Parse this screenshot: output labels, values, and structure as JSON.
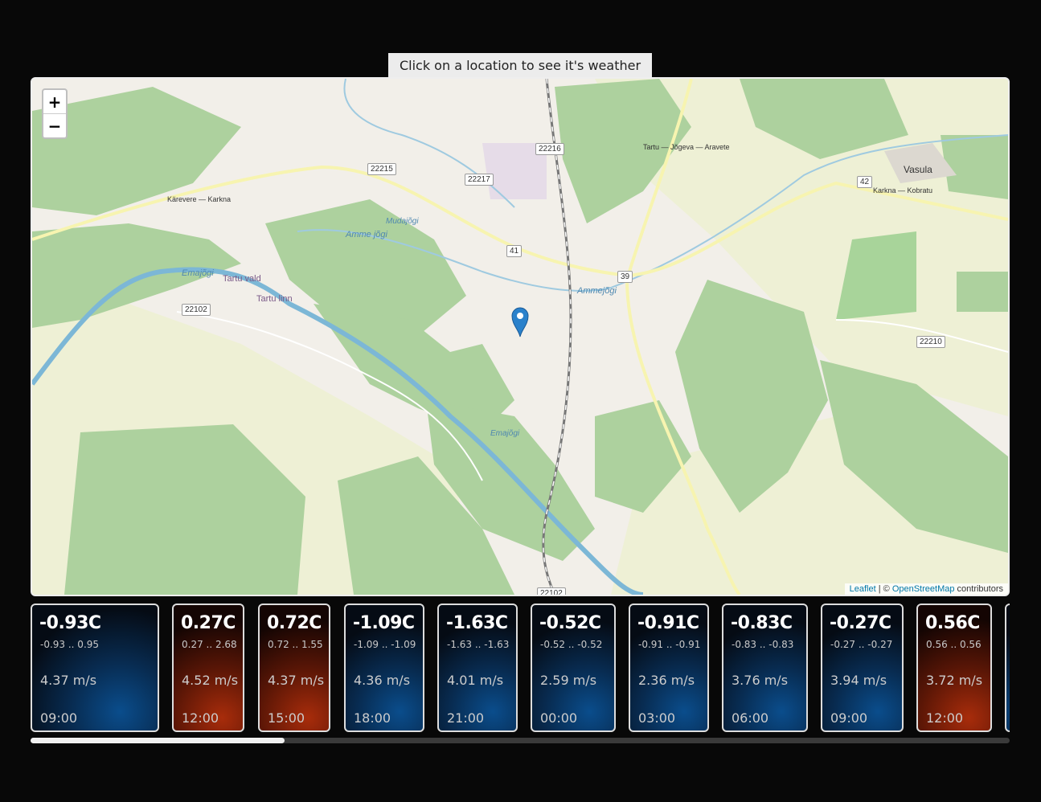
{
  "hint": "Click on a location to see it's weather",
  "map": {
    "zoom_in": "+",
    "zoom_out": "−",
    "attribution": {
      "leaflet": "Leaflet",
      "separator": " | © ",
      "osm": "OpenStreetMap",
      "suffix": " contributors"
    },
    "road_labels": [
      "22216",
      "22215",
      "22217",
      "41",
      "39",
      "42",
      "22102",
      "22210",
      "22102"
    ],
    "places": [
      "Vasula",
      "Tartu vald",
      "Tartu linn",
      "Emajõgi",
      "Amme jõgi",
      "Ammejõgi",
      "Kärevere — Karkna",
      "Karkna — Kobratu",
      "Tartu — Jõgeva — Aravete",
      "Mudajõgi",
      "Emajõgi"
    ]
  },
  "forecast": [
    {
      "temp": "-0.93C",
      "range": "-0.93 .. 0.95",
      "wind": "4.37 m/s",
      "time": "09:00",
      "tone": "cold"
    },
    {
      "temp": "0.27C",
      "range": "0.27 .. 2.68",
      "wind": "4.52 m/s",
      "time": "12:00",
      "tone": "warm"
    },
    {
      "temp": "0.72C",
      "range": "0.72 .. 1.55",
      "wind": "4.37 m/s",
      "time": "15:00",
      "tone": "warm"
    },
    {
      "temp": "-1.09C",
      "range": "-1.09 .. -1.09",
      "wind": "4.36 m/s",
      "time": "18:00",
      "tone": "cold"
    },
    {
      "temp": "-1.63C",
      "range": "-1.63 .. -1.63",
      "wind": "4.01 m/s",
      "time": "21:00",
      "tone": "cold"
    },
    {
      "temp": "-0.52C",
      "range": "-0.52 .. -0.52",
      "wind": "2.59 m/s",
      "time": "00:00",
      "tone": "cold"
    },
    {
      "temp": "-0.91C",
      "range": "-0.91 .. -0.91",
      "wind": "2.36 m/s",
      "time": "03:00",
      "tone": "cold"
    },
    {
      "temp": "-0.83C",
      "range": "-0.83 .. -0.83",
      "wind": "3.76 m/s",
      "time": "06:00",
      "tone": "cold"
    },
    {
      "temp": "-0.27C",
      "range": "-0.27 .. -0.27",
      "wind": "3.94 m/s",
      "time": "09:00",
      "tone": "cold"
    },
    {
      "temp": "0.56C",
      "range": "0.56 .. 0.56",
      "wind": "3.72 m/s",
      "time": "12:00",
      "tone": "warm"
    }
  ],
  "colors": {
    "cold": "#0a4d8c",
    "warm": "#a82c0b",
    "marker": "#2a81cb"
  }
}
